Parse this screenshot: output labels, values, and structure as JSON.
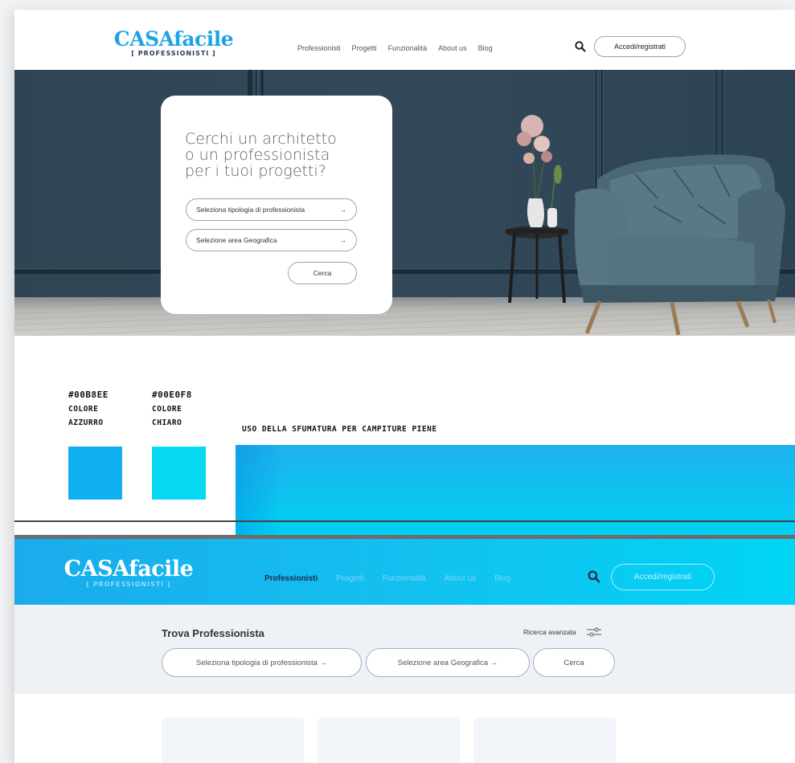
{
  "header_light": {
    "logo_word": "CASAfacile",
    "logo_sub": "[ PROFESSIONISTI ]",
    "nav": [
      "Professionisti",
      "Progetti",
      "Funzionalità",
      "About us",
      "Blog"
    ],
    "login_label": "Accedi/registrati"
  },
  "hero": {
    "title": "Cerchi  un architetto\no un professionista\nper i tuoi progetti?",
    "select_type": "Seleziona tipologia di professionista",
    "select_area": "Selezione area Geografica",
    "search_label": "Cerca",
    "arrow": "→"
  },
  "palette": {
    "color1": {
      "hex": "#00B8EE",
      "line1": "COLORE",
      "line2": "AZZURRO",
      "swatch": "#0fb0f0"
    },
    "color2": {
      "hex": "#00E0F8",
      "line1": "COLORE",
      "line2": "CHIARO",
      "swatch": "#08d9f2"
    },
    "gradient_label": "USO DELLA SFUMATURA PER CAMPITURE PIENE"
  },
  "header_blue": {
    "logo_word": "CASAfacile",
    "logo_sub": "[ PROFESSIONISTI ]",
    "nav": [
      "Professionisti",
      "Progetti",
      "Funzionalità",
      "About us",
      "Blog"
    ],
    "active": "Professionisti",
    "login_label": "Accedi/registrati"
  },
  "finder": {
    "title": "Trova Professionista",
    "advanced": "Ricerca avanzata",
    "select_type": "Seleziona tipologia di professionista →",
    "select_area": "Selezione area Geografica   →",
    "search_label": "Cerca"
  }
}
